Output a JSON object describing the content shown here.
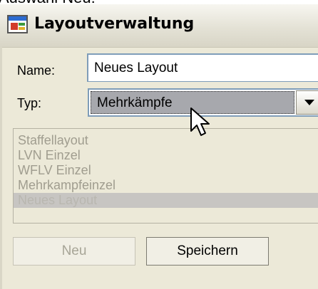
{
  "header_fragment": "Auswahl Neu:",
  "window": {
    "title": "Layoutverwaltung"
  },
  "form": {
    "name_label": "Name:",
    "name_value": "Neues Layout",
    "type_label": "Typ:",
    "type_value": "Mehrkämpfe"
  },
  "list": {
    "items": [
      "Staffellayout",
      "LVN Einzel",
      "WFLV Einzel",
      "Mehrkampfeinzel",
      "Neues Layout"
    ],
    "selected_index": 4
  },
  "buttons": {
    "new_label": "Neu",
    "save_label": "Speichern"
  },
  "icons": {
    "title": "app-window-icon",
    "dropdown": "chevron-down-icon",
    "cursor": "mouse-pointer-icon"
  },
  "colors": {
    "selection": "#a7a8ad",
    "disabled_text": "#a09d8f",
    "window_bg": "#ece9d8"
  }
}
